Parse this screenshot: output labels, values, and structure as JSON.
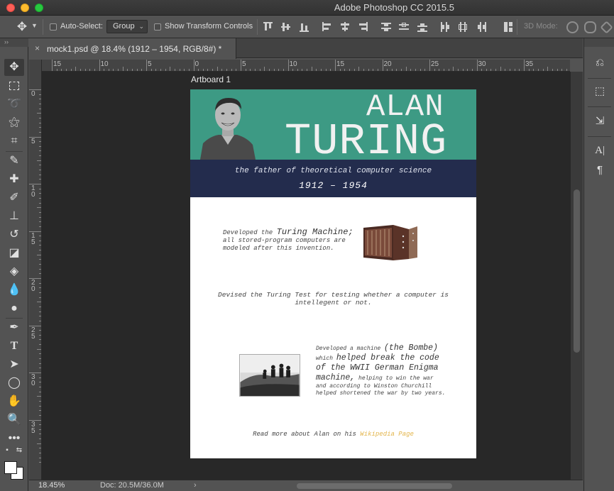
{
  "window": {
    "title": "Adobe Photoshop CC 2015.5"
  },
  "options_bar": {
    "auto_select_label": "Auto-Select:",
    "auto_select_value": "Group",
    "show_transform_label": "Show Transform Controls",
    "mode_3d_label": "3D Mode:"
  },
  "document": {
    "tab_title": "mock1.psd @ 18.4% (1912 – 1954, RGB/8#) *",
    "tab_close_glyph": "×",
    "artboard_label": "Artboard 1"
  },
  "rulers": {
    "horizontal": [
      "15",
      "10",
      "5",
      "0",
      "5",
      "10",
      "15",
      "20",
      "25",
      "30",
      "35"
    ],
    "vertical": [
      "0",
      "5",
      "10",
      "15",
      "20",
      "25",
      "30",
      "35"
    ]
  },
  "artboard": {
    "colors": {
      "hero": "#3d9a84",
      "band": "#232c4d",
      "link": "#e3b54c"
    },
    "hero_line1": "ALAN",
    "hero_line2": "TURING",
    "tagline": "the father of theoretical computer science",
    "years": "1912 – 1954",
    "para1_a": "Developed the ",
    "para1_b": "Turing Machine;",
    "para1_c": "all stored-program computers are modeled after this invention.",
    "para2": "Devised the Turing Test for testing whether a computer is intellegent or not.",
    "para3_a": "Developed a machine ",
    "para3_b": "(the Bombe)",
    "para3_c": "which ",
    "para3_d": "helped break the code of the WWII German Enigma machine,",
    "para3_e": " helping to win the war and according to Winston Churchill helped shortened the war by two years.",
    "footer_prefix": "Read more about Alan on his ",
    "footer_link": "Wikipedia Page"
  },
  "status": {
    "zoom": "18.45%",
    "doc_size": "Doc: 20.5M/36.0M"
  },
  "tools": [
    "move-tool",
    "marquee-tool",
    "lasso-tool",
    "magic-wand-tool",
    "crop-tool",
    "eyedropper-tool",
    "healing-brush-tool",
    "brush-tool",
    "clone-stamp-tool",
    "history-brush-tool",
    "eraser-tool",
    "paint-bucket-tool",
    "blur-tool",
    "dodge-tool",
    "pen-tool",
    "type-tool",
    "path-selection-tool",
    "ellipse-tool",
    "hand-tool",
    "zoom-tool",
    "more-tools"
  ],
  "right_dock": [
    "history-icon",
    "3d-icon",
    "adjust-icon",
    "character-icon",
    "paragraph-icon"
  ]
}
